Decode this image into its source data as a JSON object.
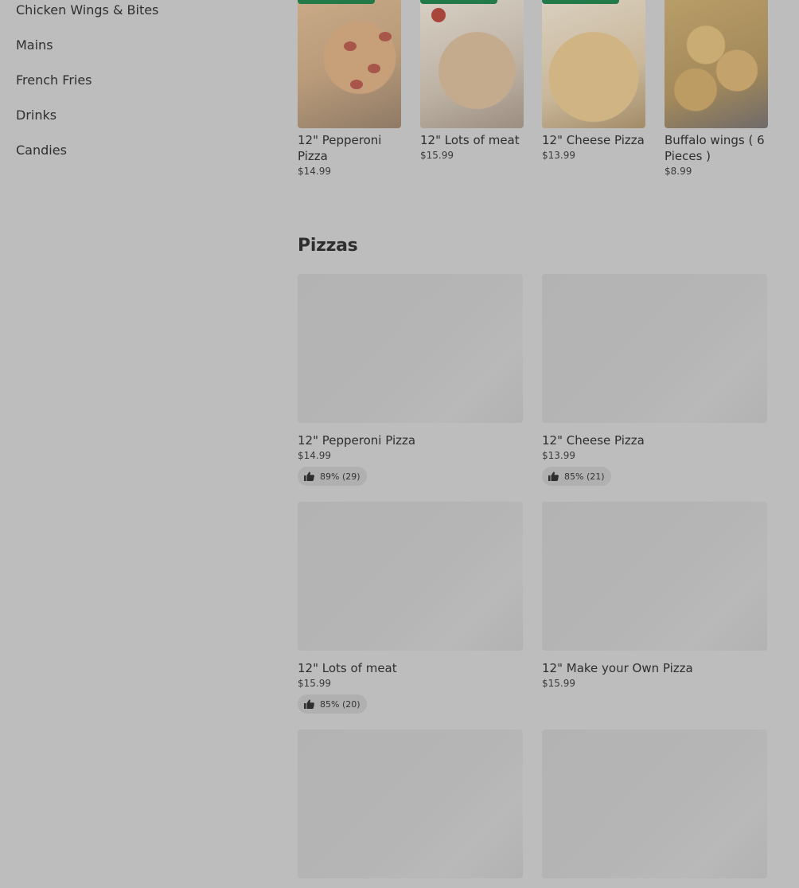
{
  "sidebar": {
    "items": [
      {
        "label": "Chicken Wings & Bites"
      },
      {
        "label": "Mains"
      },
      {
        "label": "French Fries"
      },
      {
        "label": "Drinks"
      },
      {
        "label": "Candies"
      }
    ]
  },
  "featured": {
    "items": [
      {
        "name": "12\" Pepperoni Pizza",
        "price": "$14.99",
        "image_icon": "pepperoni-pizza-image"
      },
      {
        "name": "12\" Lots of meat",
        "price": "$15.99",
        "image_icon": "meat-pizza-image"
      },
      {
        "name": "12\" Cheese Pizza",
        "price": "$13.99",
        "image_icon": "cheese-pizza-image"
      },
      {
        "name": "Buffalo wings ( 6 Pieces )",
        "price": "$8.99",
        "image_icon": "buffalo-wings-image"
      }
    ],
    "ribbon_color": "#217a47"
  },
  "section": {
    "title": "Pizzas",
    "items": [
      {
        "name": "12\" Pepperoni Pizza",
        "price": "$14.99",
        "rating": "89% (29)"
      },
      {
        "name": "12\" Cheese Pizza",
        "price": "$13.99",
        "rating": "85% (21)"
      },
      {
        "name": "12\" Lots of meat",
        "price": "$15.99",
        "rating": "85% (20)"
      },
      {
        "name": "12\" Make your Own Pizza",
        "price": "$15.99",
        "rating": ""
      },
      {
        "name": "",
        "price": "",
        "rating": ""
      },
      {
        "name": "",
        "price": "",
        "rating": ""
      }
    ]
  }
}
